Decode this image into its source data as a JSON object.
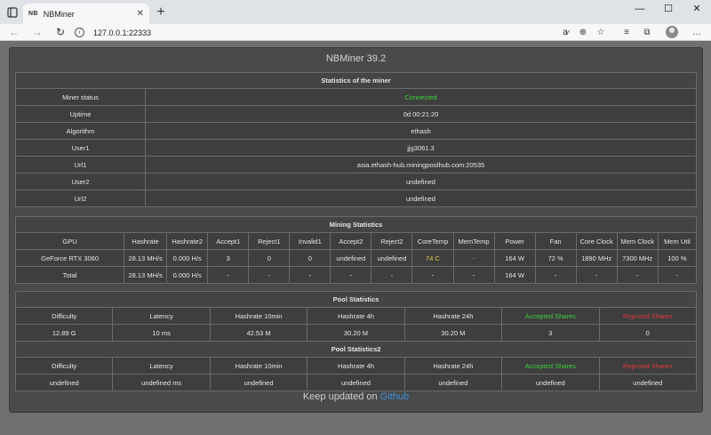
{
  "browser": {
    "tab_favicon": "NB",
    "tab_title": "NBMiner",
    "url": "127.0.0.1:22333",
    "win_min": "—",
    "win_max": "☐",
    "win_close": "✕"
  },
  "app": {
    "title": "NBMiner 39.2"
  },
  "stats": {
    "caption": "Statistics of the miner",
    "rows": [
      {
        "label": "Miner status",
        "value": "Connected"
      },
      {
        "label": "Uptime",
        "value": "0d 00:21:20"
      },
      {
        "label": "Algorithm",
        "value": "ethash"
      },
      {
        "label": "User1",
        "value": "jjg3061.3"
      },
      {
        "label": "Url1",
        "value": "asia.ethash-hub.miningpoolhub.com:20535"
      },
      {
        "label": "User2",
        "value": "undefined"
      },
      {
        "label": "Url2",
        "value": "undefined"
      }
    ]
  },
  "mining": {
    "caption": "Mining Statistics",
    "headers": [
      "GPU",
      "Hashrate",
      "Hashrate2",
      "Accept1",
      "Reject1",
      "Invalid1",
      "Accept2",
      "Reject2",
      "CoreTemp",
      "MemTemp",
      "Power",
      "Fan",
      "Core Clock",
      "Mem Clock",
      "Mem Util"
    ],
    "rows": [
      [
        "GeForce RTX 3060",
        "28.13 MH/s",
        "0.000 H/s",
        "3",
        "0",
        "0",
        "undefined",
        "undefined",
        "74 C",
        "-",
        "164 W",
        "72 %",
        "1890 MHz",
        "7300 MHz",
        "100 %"
      ],
      [
        "Total",
        "28.13 MH/s",
        "0.000 H/s",
        "-",
        "-",
        "-",
        "-",
        "-",
        "-",
        "-",
        "164 W",
        "-",
        "-",
        "-",
        "-"
      ]
    ]
  },
  "pool": {
    "caption": "Pool Statistics",
    "headers": [
      "Difficulty",
      "Latency",
      "Hashrate 10min",
      "Hashrate 4h",
      "Hashrate 24h",
      "Accepted Shares",
      "Rejected Shares"
    ],
    "row": [
      "12.89 G",
      "10 ms",
      "42.53 M",
      "30.20 M",
      "30.20 M",
      "3",
      "0"
    ]
  },
  "pool2": {
    "caption": "Pool Statistics2",
    "headers": [
      "Difficulty",
      "Latency",
      "Hashrate 10min",
      "Hashrate 4h",
      "Hashrate 24h",
      "Accepted Shares",
      "Rejected Shares"
    ],
    "row": [
      "undefined",
      "undefined ms",
      "undefined",
      "undefined",
      "undefined",
      "undefined",
      "undefined"
    ]
  },
  "footer": {
    "text": "Keep updated on",
    "link": "Github"
  },
  "colors": {
    "connected": "#3ccf3c",
    "accepted": "#3ccf3c",
    "rejected": "#e03a3a",
    "temp": "#e3cf55"
  }
}
